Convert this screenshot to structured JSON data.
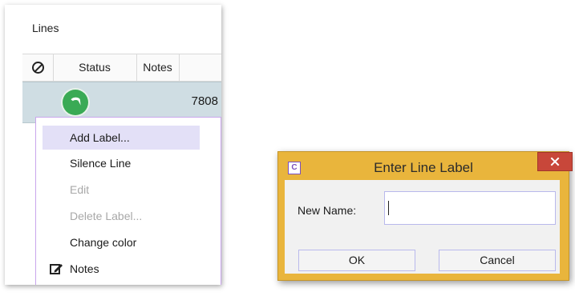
{
  "lines_panel": {
    "title": "Lines",
    "columns": [
      "Status",
      "Notes"
    ],
    "block_icon": "block-icon",
    "row": {
      "status_icon": "phone-icon",
      "status_color": "#3aaa55",
      "number": "7808"
    }
  },
  "context_menu": {
    "items": [
      {
        "label": "Add Label...",
        "state": "highlighted"
      },
      {
        "label": "Silence Line",
        "state": "enabled"
      },
      {
        "label": "Edit",
        "state": "disabled"
      },
      {
        "label": "Delete Label...",
        "state": "disabled"
      },
      {
        "label": "Change color",
        "state": "enabled"
      },
      {
        "label": "Notes",
        "state": "enabled",
        "icon": "edit-icon"
      }
    ]
  },
  "dialog": {
    "icon_letter": "C",
    "title": "Enter Line Label",
    "close_icon": "close-icon",
    "field_label": "New Name:",
    "field_value": "",
    "ok_label": "OK",
    "cancel_label": "Cancel",
    "accent": "#e9b53c",
    "close_color": "#c8473a"
  }
}
